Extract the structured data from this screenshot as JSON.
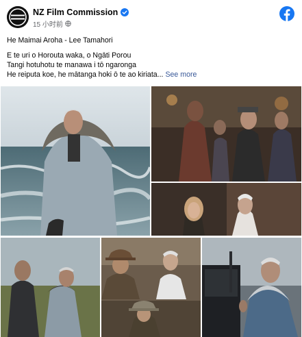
{
  "post": {
    "page_name": "NZ Film Commission",
    "verified_icon": "verified-badge-icon",
    "timestamp": "15 小时前",
    "privacy_icon": "globe-icon",
    "title_line": "He Maimai Aroha - Lee Tamahori",
    "body_lines": [
      "E te uri o Horouta waka, o Ngāti Porou",
      "Tangi hotuhotu te manawa i tō ngaronga",
      "He reiputa koe, he mātanga hoki ō te ao kiriata..."
    ],
    "see_more": "See more"
  },
  "colors": {
    "facebook_blue": "#1877f2",
    "link": "#385898",
    "muted": "#65676b"
  },
  "photos": [
    {
      "name": "photo-man-in-parka-by-sea"
    },
    {
      "name": "photo-film-still-group"
    },
    {
      "name": "photo-woman-and-man-portrait"
    },
    {
      "name": "photo-two-men-outdoors"
    },
    {
      "name": "photo-men-in-hats"
    },
    {
      "name": "photo-director-at-camera"
    }
  ]
}
